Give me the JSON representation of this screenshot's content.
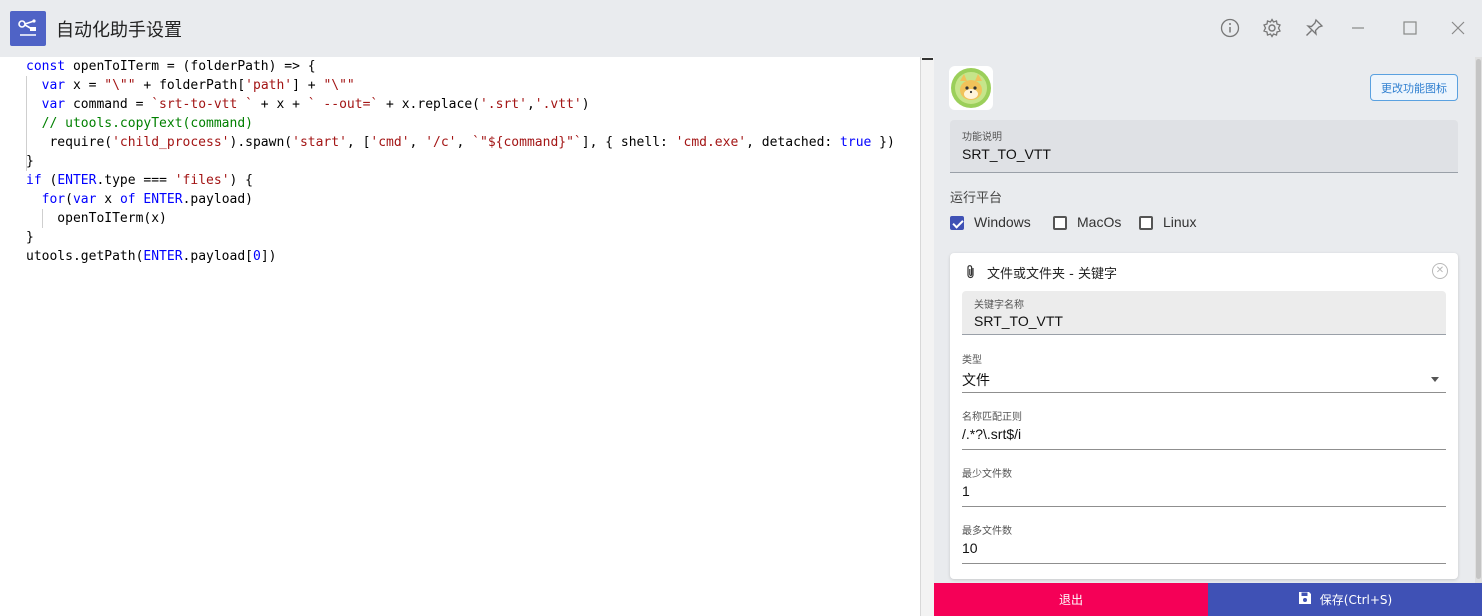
{
  "window": {
    "title": "自动化助手设置"
  },
  "titlebar_icons": [
    "info-icon",
    "gear-icon",
    "pin-icon",
    "minimize-icon",
    "maximize-icon",
    "close-icon"
  ],
  "editor": {
    "lines": [
      [
        {
          "t": "const",
          "c": "kw"
        },
        {
          "t": " openToITerm = (folderPath) => {",
          "c": ""
        }
      ],
      [
        {
          "t": "  ",
          "c": ""
        },
        {
          "t": "var",
          "c": "kw"
        },
        {
          "t": " x = ",
          "c": ""
        },
        {
          "t": "\"\\\"\"",
          "c": "str"
        },
        {
          "t": " + folderPath[",
          "c": ""
        },
        {
          "t": "'path'",
          "c": "str"
        },
        {
          "t": "] + ",
          "c": ""
        },
        {
          "t": "\"\\\"\"",
          "c": "str"
        }
      ],
      [
        {
          "t": "  ",
          "c": ""
        },
        {
          "t": "var",
          "c": "kw"
        },
        {
          "t": " command = ",
          "c": ""
        },
        {
          "t": "`srt-to-vtt `",
          "c": "str"
        },
        {
          "t": " + x + ",
          "c": ""
        },
        {
          "t": "` --out=`",
          "c": "str"
        },
        {
          "t": " + x.replace(",
          "c": ""
        },
        {
          "t": "'.srt'",
          "c": "str"
        },
        {
          "t": ",",
          "c": ""
        },
        {
          "t": "'.vtt'",
          "c": "str"
        },
        {
          "t": ")",
          "c": ""
        }
      ],
      [
        {
          "t": "  ",
          "c": ""
        },
        {
          "t": "// utools.copyText(command)",
          "c": "cm"
        }
      ],
      [
        {
          "t": "   require(",
          "c": ""
        },
        {
          "t": "'child_process'",
          "c": "str"
        },
        {
          "t": ").spawn(",
          "c": ""
        },
        {
          "t": "'start'",
          "c": "str"
        },
        {
          "t": ", [",
          "c": ""
        },
        {
          "t": "'cmd'",
          "c": "str"
        },
        {
          "t": ", ",
          "c": ""
        },
        {
          "t": "'/c'",
          "c": "str"
        },
        {
          "t": ", ",
          "c": ""
        },
        {
          "t": "`\"${command}\"`",
          "c": "str"
        },
        {
          "t": "], { shell: ",
          "c": ""
        },
        {
          "t": "'cmd.exe'",
          "c": "str"
        },
        {
          "t": ", detached: ",
          "c": ""
        },
        {
          "t": "true",
          "c": "kw"
        },
        {
          "t": " })",
          "c": ""
        }
      ],
      [
        {
          "t": "}",
          "c": ""
        }
      ],
      [
        {
          "t": "if",
          "c": "kw"
        },
        {
          "t": " (",
          "c": ""
        },
        {
          "t": "ENTER",
          "c": "kw"
        },
        {
          "t": ".type === ",
          "c": ""
        },
        {
          "t": "'files'",
          "c": "str"
        },
        {
          "t": ") {",
          "c": ""
        }
      ],
      [
        {
          "t": "  ",
          "c": ""
        },
        {
          "t": "for",
          "c": "kw"
        },
        {
          "t": "(",
          "c": ""
        },
        {
          "t": "var",
          "c": "kw"
        },
        {
          "t": " x ",
          "c": ""
        },
        {
          "t": "of",
          "c": "kw"
        },
        {
          "t": " ",
          "c": ""
        },
        {
          "t": "ENTER",
          "c": "kw"
        },
        {
          "t": ".payload)",
          "c": ""
        }
      ],
      [
        {
          "t": "    openToITerm(x)",
          "c": ""
        }
      ],
      [
        {
          "t": "}",
          "c": ""
        }
      ],
      [
        {
          "t": "utools.getPath(",
          "c": ""
        },
        {
          "t": "ENTER",
          "c": "kw"
        },
        {
          "t": ".payload[",
          "c": ""
        },
        {
          "t": "0",
          "c": "kw"
        },
        {
          "t": "])",
          "c": ""
        }
      ]
    ]
  },
  "panel": {
    "change_icon_label": "更改功能图标",
    "explain_label": "功能说明",
    "explain_value": "SRT_TO_VTT",
    "platform_title": "运行平台",
    "platforms": [
      {
        "label": "Windows",
        "checked": true
      },
      {
        "label": "MacOs",
        "checked": false
      },
      {
        "label": "Linux",
        "checked": false
      }
    ],
    "card": {
      "title": "文件或文件夹 - 关键字",
      "keyword_label": "关键字名称",
      "keyword_value": "SRT_TO_VTT",
      "type_label": "类型",
      "type_value": "文件",
      "regex_label": "名称匹配正则",
      "regex_value": "/.*?\\.srt$/i",
      "min_label": "最少文件数",
      "min_value": "1",
      "max_label": "最多文件数",
      "max_value": "10"
    }
  },
  "buttons": {
    "exit_label": "退出",
    "save_label": "保存(Ctrl+S)"
  },
  "colors": {
    "accent": "#3f51b5",
    "exit": "#f50057",
    "titlebar_bg": "#e9ebee"
  }
}
